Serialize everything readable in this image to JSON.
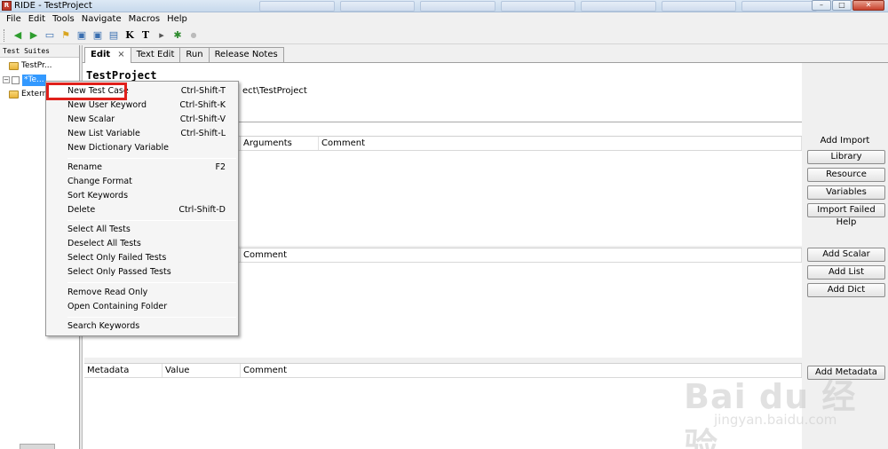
{
  "window": {
    "title": "RIDE - TestProject",
    "icon_letter": "R",
    "controls": {
      "minimize": "–",
      "maximize": "□",
      "close": "✕"
    }
  },
  "menubar": {
    "items": [
      {
        "label": "File"
      },
      {
        "label": "Edit"
      },
      {
        "label": "Tools"
      },
      {
        "label": "Navigate"
      },
      {
        "label": "Macros"
      },
      {
        "label": "Help"
      }
    ]
  },
  "toolbar": {
    "buttons": [
      {
        "icon": "back-arrow-icon",
        "glyph": "◀"
      },
      {
        "icon": "forward-arrow-icon",
        "glyph": "▶"
      },
      {
        "icon": "open-folder-icon",
        "glyph": "▭"
      },
      {
        "icon": "open-dir-icon",
        "glyph": "⚑"
      },
      {
        "icon": "save-icon",
        "glyph": "▣"
      },
      {
        "icon": "save-all-icon",
        "glyph": "▣"
      },
      {
        "icon": "copy-icon",
        "glyph": "▤"
      },
      {
        "icon": "keyword-search-icon",
        "glyph": "K"
      },
      {
        "icon": "test-search-icon",
        "glyph": "T"
      },
      {
        "icon": "run-icon",
        "glyph": "▸"
      },
      {
        "icon": "bug-icon",
        "glyph": "✱"
      },
      {
        "icon": "stop-icon",
        "glyph": "●"
      }
    ]
  },
  "tree": {
    "header": "Test Suites",
    "root_label": "TestPr...",
    "selected_label": "*Te...",
    "external_label": "Extern",
    "expander_glyph": "−"
  },
  "tabs": [
    {
      "label": "Edit",
      "active": true,
      "close": "×"
    },
    {
      "label": "Text Edit"
    },
    {
      "label": "Run"
    },
    {
      "label": "Release Notes"
    }
  ],
  "editor": {
    "suite_title": "TestProject",
    "source_fragment": "ect\\TestProject",
    "imports_grid": {
      "headers": [
        "Arguments",
        "Comment"
      ]
    },
    "variables_grid": {
      "headers": [
        "Comment"
      ]
    },
    "metadata_grid": {
      "headers": [
        "Metadata",
        "Value",
        "Comment"
      ]
    }
  },
  "side_panel": {
    "add_import_label": "Add Import",
    "buttons": {
      "library": "Library",
      "resource": "Resource",
      "variables": "Variables",
      "import_failed_help": "Import Failed Help",
      "add_scalar": "Add Scalar",
      "add_list": "Add List",
      "add_dict": "Add Dict",
      "add_metadata": "Add Metadata"
    }
  },
  "context_menu": {
    "items": [
      {
        "label": "New Test Case",
        "shortcut": "Ctrl-Shift-T",
        "highlighted": true
      },
      {
        "label": "New User Keyword",
        "shortcut": "Ctrl-Shift-K"
      },
      {
        "label": "New Scalar",
        "shortcut": "Ctrl-Shift-V"
      },
      {
        "label": "New List Variable",
        "shortcut": "Ctrl-Shift-L"
      },
      {
        "label": "New Dictionary Variable",
        "shortcut": ""
      },
      {
        "label": "Rename",
        "shortcut": "F2"
      },
      {
        "label": "Change Format",
        "shortcut": ""
      },
      {
        "label": "Sort Keywords",
        "shortcut": ""
      },
      {
        "label": "Delete",
        "shortcut": "Ctrl-Shift-D"
      },
      {
        "label": "Select All Tests",
        "shortcut": ""
      },
      {
        "label": "Deselect All Tests",
        "shortcut": ""
      },
      {
        "label": "Select Only Failed Tests",
        "shortcut": ""
      },
      {
        "label": "Select Only Passed Tests",
        "shortcut": ""
      },
      {
        "label": "Remove Read Only",
        "shortcut": ""
      },
      {
        "label": "Open Containing Folder",
        "shortcut": ""
      },
      {
        "label": "Search Keywords",
        "shortcut": ""
      }
    ]
  },
  "watermark": {
    "main": "Bai du 经验",
    "sub": "jingyan.baidu.com"
  }
}
